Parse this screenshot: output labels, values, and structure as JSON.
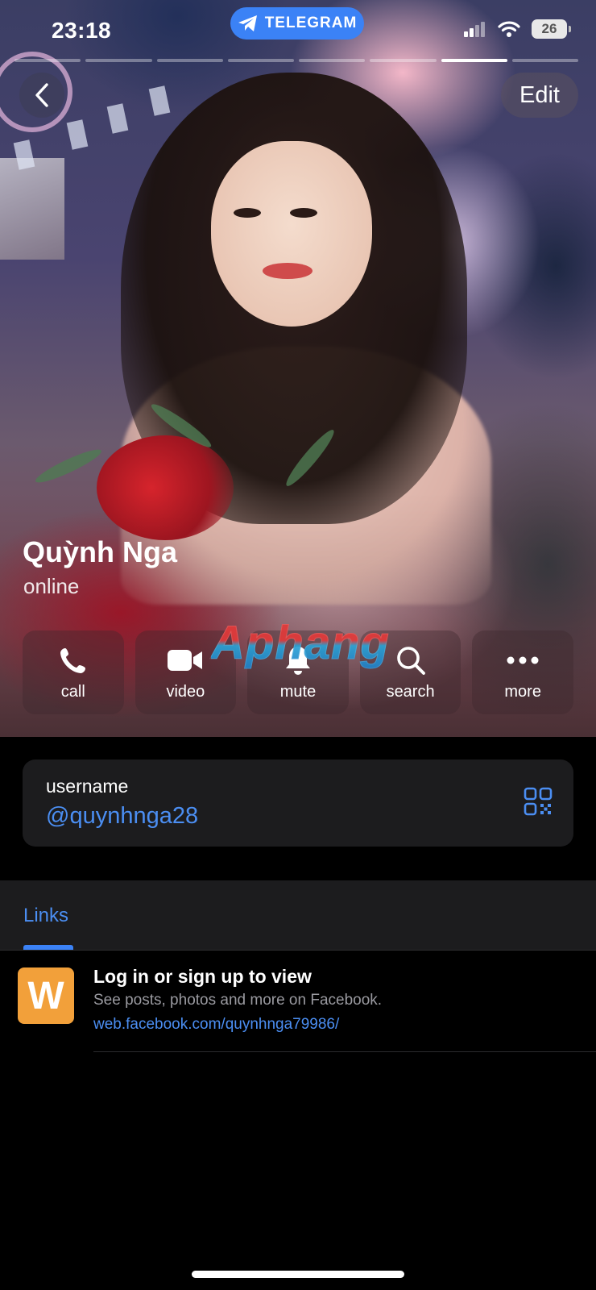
{
  "status_bar": {
    "time": "23:18",
    "app_pill": "TELEGRAM",
    "battery": "26"
  },
  "story": {
    "segments": 7,
    "active_index": 6
  },
  "header": {
    "edit_label": "Edit"
  },
  "profile": {
    "name": "Quỳnh Nga",
    "status": "online"
  },
  "actions": [
    {
      "label": "call",
      "icon": "phone-icon"
    },
    {
      "label": "video",
      "icon": "video-camera-icon"
    },
    {
      "label": "mute",
      "icon": "bell-icon"
    },
    {
      "label": "search",
      "icon": "search-icon"
    },
    {
      "label": "more",
      "icon": "more-dots-icon"
    }
  ],
  "watermark": "Aphang",
  "username": {
    "label": "username",
    "value": "@quynhnga28"
  },
  "links": {
    "tab": "Links",
    "item": {
      "thumb_letter": "W",
      "title": "Log in or sign up to view",
      "description": "See posts, photos and more on Facebook.",
      "url": "web.facebook.com/quynhnga79986/"
    }
  },
  "colors": {
    "accent": "#4b8ef2",
    "telegram_pill": "#3b82f6",
    "card_bg": "#1c1c1e",
    "link_thumb": "#f2a03a"
  }
}
